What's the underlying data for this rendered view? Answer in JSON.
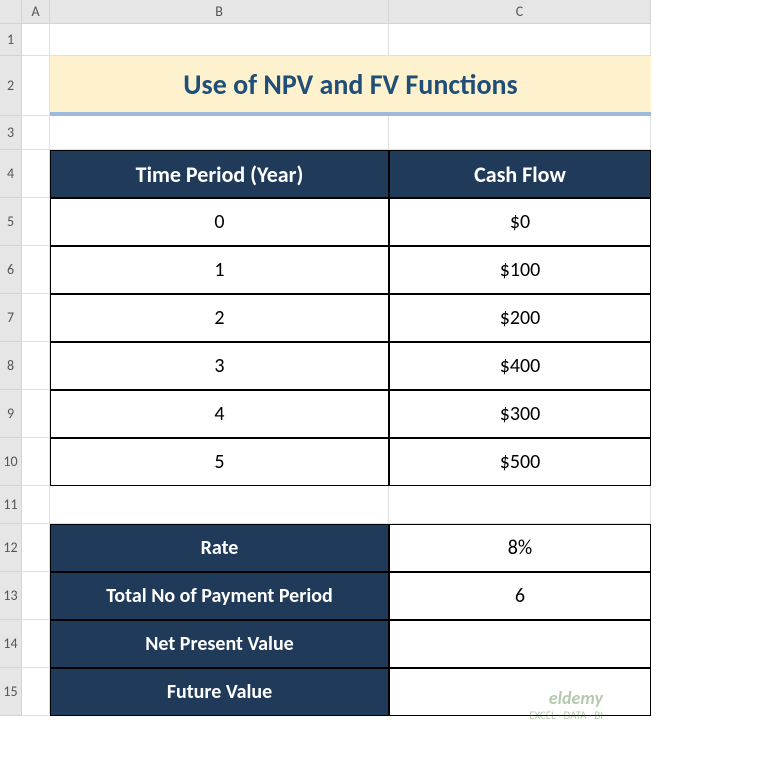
{
  "columns": [
    "A",
    "B",
    "C"
  ],
  "rows": [
    "1",
    "2",
    "3",
    "4",
    "5",
    "6",
    "7",
    "8",
    "9",
    "10",
    "11",
    "12",
    "13",
    "14",
    "15"
  ],
  "title": "Use of NPV and FV Functions",
  "table1": {
    "headers": [
      "Time Period (Year)",
      "Cash Flow"
    ],
    "data": [
      [
        "0",
        "$0"
      ],
      [
        "1",
        "$100"
      ],
      [
        "2",
        "$200"
      ],
      [
        "3",
        "$400"
      ],
      [
        "4",
        "$300"
      ],
      [
        "5",
        "$500"
      ]
    ]
  },
  "params": [
    {
      "label": "Rate",
      "value": "8%"
    },
    {
      "label": "Total No of Payment Period",
      "value": "6"
    },
    {
      "label": "Net Present Value",
      "value": ""
    },
    {
      "label": "Future Value",
      "value": ""
    }
  ],
  "watermark": {
    "brand": "eldemy",
    "tag": "EXCEL · DATA · BI"
  }
}
